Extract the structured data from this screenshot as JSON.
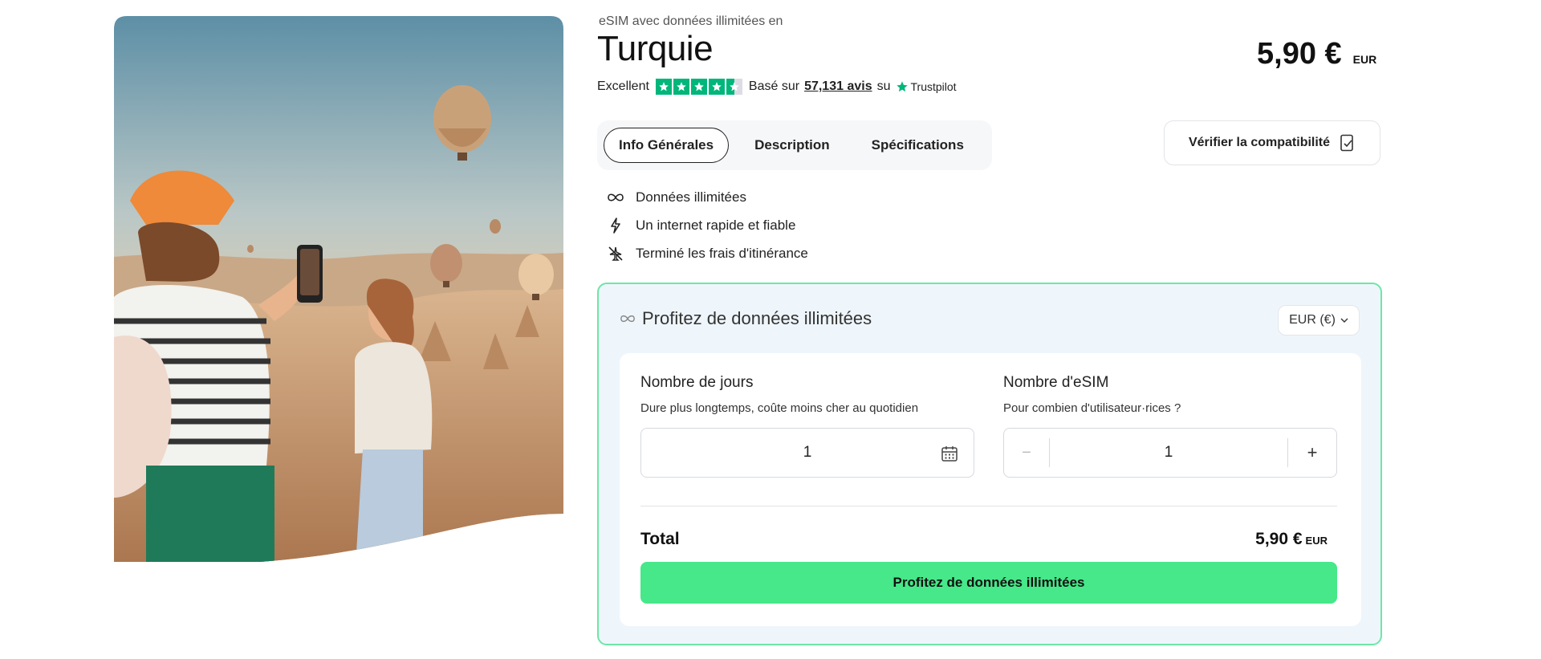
{
  "product": {
    "subtitle": "eSIM avec données illimitées en",
    "title": "Turquie",
    "price_amount": "5,90 €",
    "price_currency": "EUR"
  },
  "rating": {
    "label": "Excellent",
    "stars": 4.5,
    "based_text": "Basé sur",
    "reviews_text": "57,131 avis",
    "su_text": "su",
    "provider": "Trustpilot"
  },
  "tabs": [
    {
      "label": "Info Générales",
      "active": true
    },
    {
      "label": "Description",
      "active": false
    },
    {
      "label": "Spécifications",
      "active": false
    }
  ],
  "compat_button": {
    "label": "Vérifier la compatibilité"
  },
  "features": [
    {
      "icon": "infinity-icon",
      "label": "Données illimitées"
    },
    {
      "icon": "lightning-icon",
      "label": "Un internet rapide et fiable"
    },
    {
      "icon": "no-plane-icon",
      "label": "Terminé les frais d'itinérance"
    }
  ],
  "card": {
    "heading": "Profitez de données illimitées",
    "currency_select": "EUR (€)",
    "days": {
      "title": "Nombre de jours",
      "description": "Dure plus longtemps, coûte moins cher au quotidien",
      "value": "1"
    },
    "esims": {
      "title": "Nombre d'eSIM",
      "description": "Pour combien d'utilisateur·rices ?",
      "minus": "−",
      "value": "1",
      "plus": "+"
    },
    "total_label": "Total",
    "total_amount": "5,90 €",
    "total_currency": "EUR",
    "cta_label": "Profitez de données illimitées"
  },
  "colors": {
    "accent_green": "#46e889",
    "trustpilot_green": "#00b67a",
    "card_border": "#6ee6a6",
    "card_bg": "#eef6fc"
  }
}
